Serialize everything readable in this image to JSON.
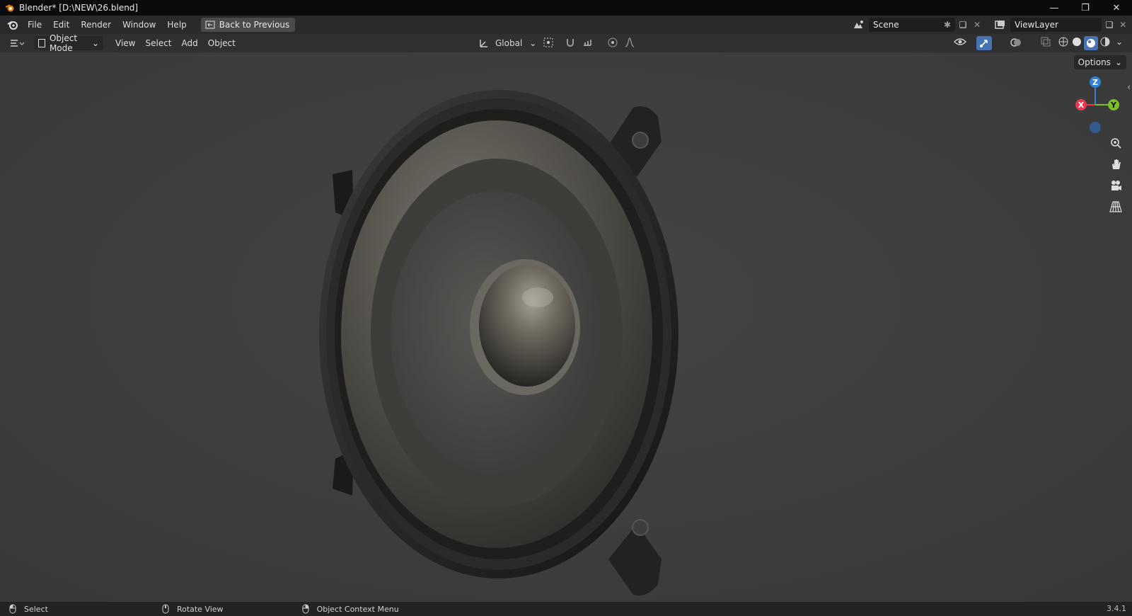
{
  "window": {
    "title": "Blender* [D:\\NEW\\26.blend]",
    "minimize_icon": "minimize-icon",
    "maximize_icon": "restore-icon",
    "close_icon": "close-icon"
  },
  "topbar": {
    "menus": [
      "File",
      "Edit",
      "Render",
      "Window",
      "Help"
    ],
    "back_label": "Back to Previous",
    "scene_label": "Scene",
    "viewlayer_label": "ViewLayer"
  },
  "header": {
    "mode_label": "Object Mode",
    "menus": [
      "View",
      "Select",
      "Add",
      "Object"
    ],
    "orientation_label": "Global"
  },
  "viewport": {
    "options_label": "Options",
    "gizmo": {
      "z": "Z",
      "x": "X",
      "y": "Y"
    },
    "tools": [
      "select-box-icon",
      "cursor-icon",
      "move-icon",
      "rotate-icon",
      "scale-icon",
      "transform-icon",
      "annotate-icon",
      "measure-icon",
      "add-cube-icon"
    ]
  },
  "statusbar": {
    "select_label": "Select",
    "rotate_label": "Rotate View",
    "context_label": "Object Context Menu",
    "version": "3.4.1"
  },
  "colors": {
    "accent": "#4772b3",
    "axis_x": "#e8374f",
    "axis_y": "#7ac02a",
    "axis_z": "#2f83d6"
  }
}
